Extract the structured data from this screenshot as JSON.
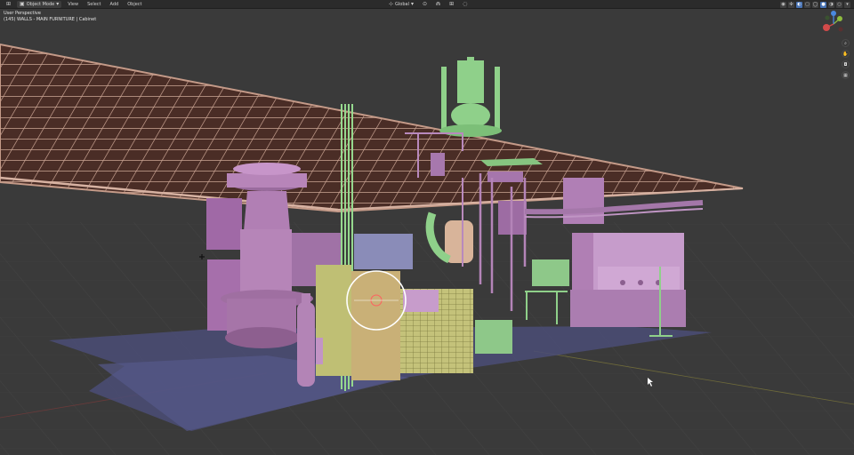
{
  "header": {
    "editor_type_icon": "grid-editor-icon",
    "mode_label": "Object Mode",
    "menus": [
      "View",
      "Select",
      "Add",
      "Object"
    ],
    "orientation_label": "Global"
  },
  "overlay": {
    "view_name": "User Perspective",
    "collection_info": "(145) WALLS - MAIN FURNITURE | Cabinet"
  },
  "colors": {
    "background": "#3a3a3a",
    "header": "#2b2b2b",
    "ceiling": "#c49a88",
    "magenta_parts": "#b078b4",
    "green_parts": "#8fd08a",
    "yellow_parts": "#c9c779",
    "floor_plane": "#4a4d77",
    "selection_outline": "#ffffff"
  },
  "gizmo": {
    "axes": [
      "X",
      "Y",
      "Z"
    ]
  }
}
